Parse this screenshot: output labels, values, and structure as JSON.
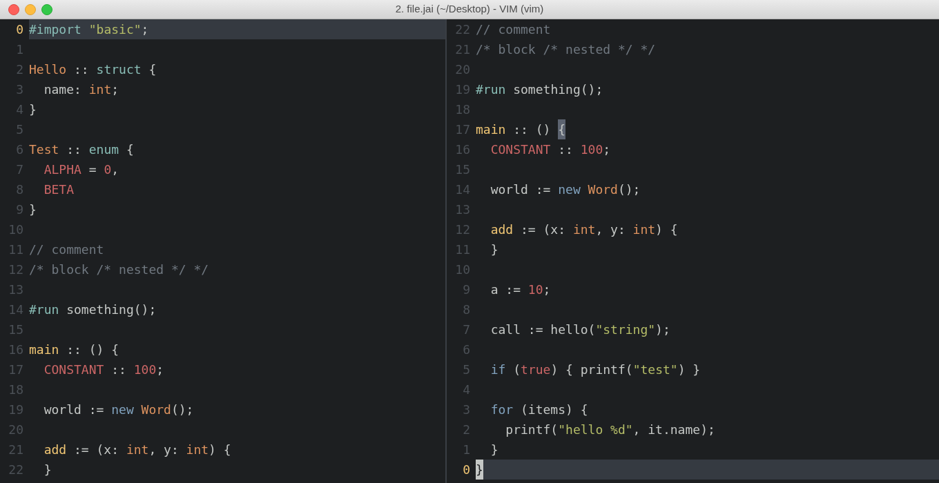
{
  "window": {
    "title": "2. file.jai (~/Desktop) - VIM (vim)"
  },
  "panes": [
    {
      "lines": [
        {
          "num": "0",
          "current": true,
          "tokens": [
            {
              "kind": "keyword",
              "text": "#import "
            },
            {
              "kind": "string",
              "text": "\"basic\""
            },
            {
              "kind": "plain",
              "text": ";"
            }
          ]
        },
        {
          "num": "1",
          "current": false
        },
        {
          "num": "2",
          "current": false,
          "tokens": [
            {
              "kind": "type",
              "text": "Hello"
            },
            {
              "kind": "plain",
              "text": " :: "
            },
            {
              "kind": "keyword",
              "text": "struct"
            },
            {
              "kind": "plain",
              "text": " {"
            }
          ]
        },
        {
          "num": "3",
          "current": false,
          "tokens": [
            {
              "kind": "plain",
              "text": "  name: "
            },
            {
              "kind": "type",
              "text": "int"
            },
            {
              "kind": "plain",
              "text": ";"
            }
          ]
        },
        {
          "num": "4",
          "current": false,
          "tokens": [
            {
              "kind": "plain",
              "text": "}"
            }
          ]
        },
        {
          "num": "5",
          "current": false
        },
        {
          "num": "6",
          "current": false,
          "tokens": [
            {
              "kind": "type",
              "text": "Test"
            },
            {
              "kind": "plain",
              "text": " :: "
            },
            {
              "kind": "keyword",
              "text": "enum"
            },
            {
              "kind": "plain",
              "text": " {"
            }
          ]
        },
        {
          "num": "7",
          "current": false,
          "tokens": [
            {
              "kind": "constant",
              "text": "  ALPHA"
            },
            {
              "kind": "plain",
              "text": " = "
            },
            {
              "kind": "constant",
              "text": "0"
            },
            {
              "kind": "plain",
              "text": ","
            }
          ]
        },
        {
          "num": "8",
          "current": false,
          "tokens": [
            {
              "kind": "constant",
              "text": "  BETA"
            }
          ]
        },
        {
          "num": "9",
          "current": false,
          "tokens": [
            {
              "kind": "plain",
              "text": "}"
            }
          ]
        },
        {
          "num": "10",
          "current": false
        },
        {
          "num": "11",
          "current": false,
          "tokens": [
            {
              "kind": "comment",
              "text": "// comment"
            }
          ]
        },
        {
          "num": "12",
          "current": false,
          "tokens": [
            {
              "kind": "comment",
              "text": "/* block /* nested */ */"
            }
          ]
        },
        {
          "num": "13",
          "current": false
        },
        {
          "num": "14",
          "current": false,
          "tokens": [
            {
              "kind": "keyword",
              "text": "#run"
            },
            {
              "kind": "plain",
              "text": " something();"
            }
          ]
        },
        {
          "num": "15",
          "current": false
        },
        {
          "num": "16",
          "current": false,
          "tokens": [
            {
              "kind": "function",
              "text": "main"
            },
            {
              "kind": "plain",
              "text": " :: () {"
            }
          ]
        },
        {
          "num": "17",
          "current": false,
          "tokens": [
            {
              "kind": "constant",
              "text": "  CONSTANT"
            },
            {
              "kind": "plain",
              "text": " :: "
            },
            {
              "kind": "constant",
              "text": "100"
            },
            {
              "kind": "plain",
              "text": ";"
            }
          ]
        },
        {
          "num": "18",
          "current": false
        },
        {
          "num": "19",
          "current": false,
          "tokens": [
            {
              "kind": "plain",
              "text": "  world := "
            },
            {
              "kind": "operator",
              "text": "new "
            },
            {
              "kind": "type",
              "text": "Word"
            },
            {
              "kind": "plain",
              "text": "();"
            }
          ]
        },
        {
          "num": "20",
          "current": false
        },
        {
          "num": "21",
          "current": false,
          "tokens": [
            {
              "kind": "function",
              "text": "  add"
            },
            {
              "kind": "plain",
              "text": " := (x: "
            },
            {
              "kind": "type",
              "text": "int"
            },
            {
              "kind": "plain",
              "text": ", y: "
            },
            {
              "kind": "type",
              "text": "int"
            },
            {
              "kind": "plain",
              "text": ") {"
            }
          ]
        },
        {
          "num": "22",
          "current": false,
          "tokens": [
            {
              "kind": "plain",
              "text": "  }"
            }
          ]
        }
      ]
    },
    {
      "lines": [
        {
          "num": "22",
          "current": false,
          "tokens": [
            {
              "kind": "comment",
              "text": "// comment"
            }
          ]
        },
        {
          "num": "21",
          "current": false,
          "tokens": [
            {
              "kind": "comment",
              "text": "/* block /* nested */ */"
            }
          ]
        },
        {
          "num": "20",
          "current": false
        },
        {
          "num": "19",
          "current": false,
          "tokens": [
            {
              "kind": "keyword",
              "text": "#run"
            },
            {
              "kind": "plain",
              "text": " something();"
            }
          ]
        },
        {
          "num": "18",
          "current": false
        },
        {
          "num": "17",
          "current": false,
          "tokens": [
            {
              "kind": "function",
              "text": "main"
            },
            {
              "kind": "plain",
              "text": " :: () "
            },
            {
              "kind": "match",
              "text": "{"
            }
          ]
        },
        {
          "num": "16",
          "current": false,
          "tokens": [
            {
              "kind": "constant",
              "text": "  CONSTANT"
            },
            {
              "kind": "plain",
              "text": " :: "
            },
            {
              "kind": "constant",
              "text": "100"
            },
            {
              "kind": "plain",
              "text": ";"
            }
          ]
        },
        {
          "num": "15",
          "current": false
        },
        {
          "num": "14",
          "current": false,
          "tokens": [
            {
              "kind": "plain",
              "text": "  world := "
            },
            {
              "kind": "operator",
              "text": "new "
            },
            {
              "kind": "type",
              "text": "Word"
            },
            {
              "kind": "plain",
              "text": "();"
            }
          ]
        },
        {
          "num": "13",
          "current": false
        },
        {
          "num": "12",
          "current": false,
          "tokens": [
            {
              "kind": "function",
              "text": "  add"
            },
            {
              "kind": "plain",
              "text": " := (x: "
            },
            {
              "kind": "type",
              "text": "int"
            },
            {
              "kind": "plain",
              "text": ", y: "
            },
            {
              "kind": "type",
              "text": "int"
            },
            {
              "kind": "plain",
              "text": ") {"
            }
          ]
        },
        {
          "num": "11",
          "current": false,
          "tokens": [
            {
              "kind": "plain",
              "text": "  }"
            }
          ]
        },
        {
          "num": "10",
          "current": false
        },
        {
          "num": "9",
          "current": false,
          "tokens": [
            {
              "kind": "plain",
              "text": "  a := "
            },
            {
              "kind": "constant",
              "text": "10"
            },
            {
              "kind": "plain",
              "text": ";"
            }
          ]
        },
        {
          "num": "8",
          "current": false
        },
        {
          "num": "7",
          "current": false,
          "tokens": [
            {
              "kind": "plain",
              "text": "  call := hello("
            },
            {
              "kind": "string",
              "text": "\"string\""
            },
            {
              "kind": "plain",
              "text": ");"
            }
          ]
        },
        {
          "num": "6",
          "current": false
        },
        {
          "num": "5",
          "current": false,
          "tokens": [
            {
              "kind": "operator",
              "text": "  if"
            },
            {
              "kind": "plain",
              "text": " ("
            },
            {
              "kind": "constant",
              "text": "true"
            },
            {
              "kind": "plain",
              "text": ") { printf("
            },
            {
              "kind": "string",
              "text": "\"test\""
            },
            {
              "kind": "plain",
              "text": ") }"
            }
          ]
        },
        {
          "num": "4",
          "current": false
        },
        {
          "num": "3",
          "current": false,
          "tokens": [
            {
              "kind": "operator",
              "text": "  for"
            },
            {
              "kind": "plain",
              "text": " (items) {"
            }
          ]
        },
        {
          "num": "2",
          "current": false,
          "tokens": [
            {
              "kind": "plain",
              "text": "    printf("
            },
            {
              "kind": "string",
              "text": "\"hello %d\""
            },
            {
              "kind": "plain",
              "text": ", it.name);"
            }
          ]
        },
        {
          "num": "1",
          "current": false,
          "tokens": [
            {
              "kind": "plain",
              "text": "  }"
            }
          ]
        },
        {
          "num": "0",
          "current": true,
          "tokens": [
            {
              "kind": "cursor",
              "text": "}"
            }
          ]
        }
      ]
    }
  ]
}
